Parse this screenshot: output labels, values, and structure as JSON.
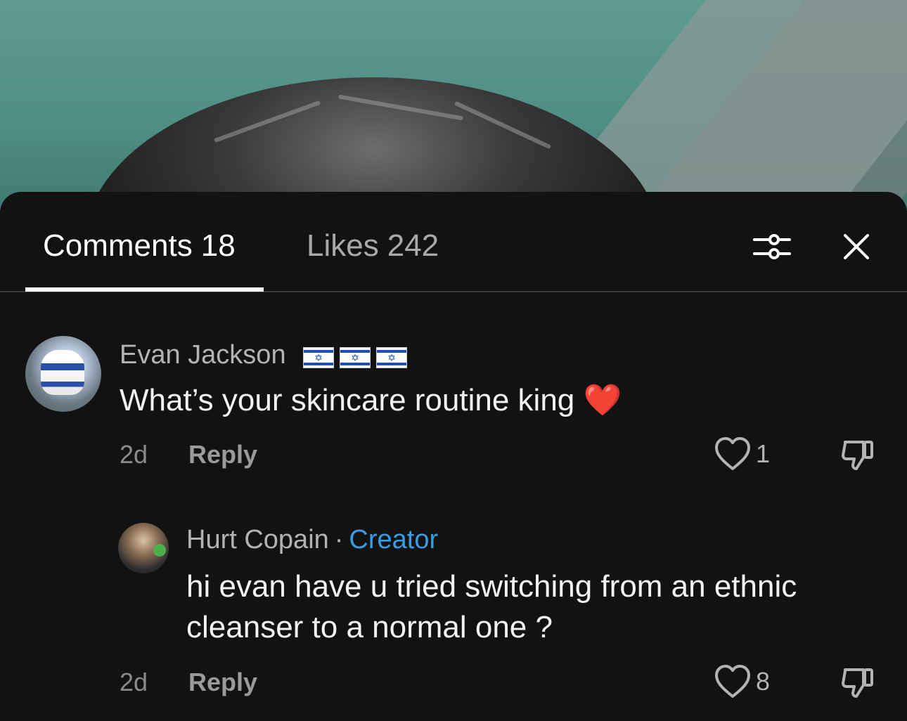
{
  "tabs": {
    "comments_label": "Comments",
    "comments_count": "18",
    "likes_label": "Likes",
    "likes_count": "242"
  },
  "toolbar": {
    "filter_icon": "sliders-icon",
    "close_icon": "close-icon"
  },
  "comments": [
    {
      "author": "Evan Jackson",
      "flags": [
        "🇮🇱",
        "🇮🇱",
        "🇮🇱"
      ],
      "text": "What’s your skincare routine king",
      "emoji": "❤️",
      "time": "2d",
      "reply_label": "Reply",
      "likes": "1"
    },
    {
      "author": "Hurt Copain",
      "separator": "·",
      "badge": "Creator",
      "text": "hi evan have u tried switching from an ethnic cleanser to a normal one ?",
      "time": "2d",
      "reply_label": "Reply",
      "likes": "8"
    }
  ],
  "colors": {
    "background": "#121212",
    "creator_accent": "#3a9ce0",
    "active_tab": "#ffffff",
    "inactive_tab": "#a9a9a9"
  }
}
